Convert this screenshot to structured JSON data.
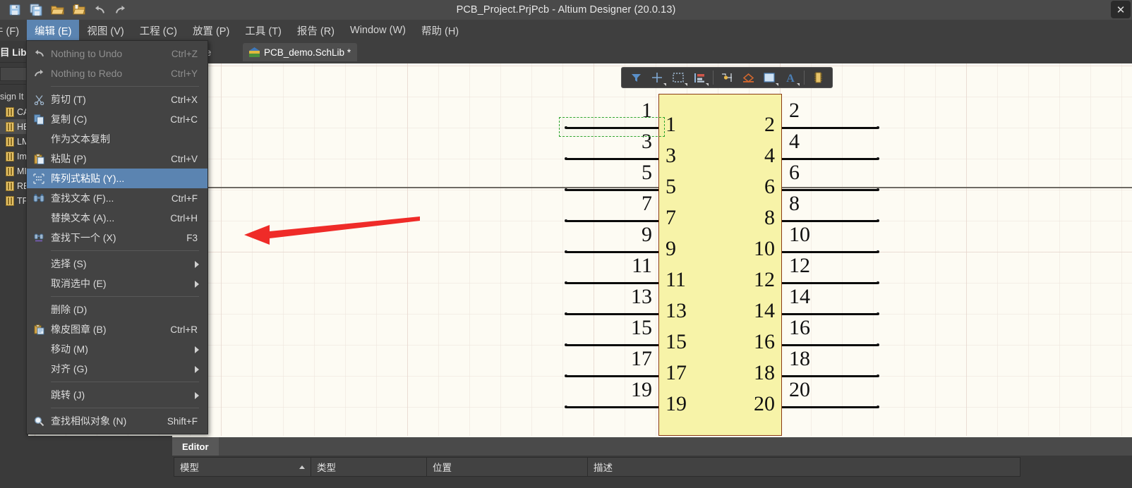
{
  "window": {
    "title": "PCB_Project.PrjPcb - Altium Designer (20.0.13)",
    "close_label": "✕",
    "toolbar_icons": [
      "save-icon",
      "save-all-icon",
      "open-folder-icon",
      "open-project-icon",
      "undo-icon",
      "redo-icon"
    ]
  },
  "menubar": {
    "items": [
      {
        "label": "件 (F)",
        "mnemonic": "F",
        "active": false
      },
      {
        "label": "编辑 (E)",
        "mnemonic": "E",
        "active": true
      },
      {
        "label": "视图 (V)",
        "mnemonic": "V",
        "active": false
      },
      {
        "label": "工程 (C)",
        "mnemonic": "C",
        "active": false
      },
      {
        "label": "放置 (P)",
        "mnemonic": "P",
        "active": false
      },
      {
        "label": "工具 (T)",
        "mnemonic": "T",
        "active": false
      },
      {
        "label": "报告 (R)",
        "mnemonic": "R",
        "active": false
      },
      {
        "label": "Window (W)",
        "mnemonic": "W",
        "active": false
      },
      {
        "label": "帮助 (H)",
        "mnemonic": "H",
        "active": false
      }
    ]
  },
  "edit_menu": {
    "items": [
      {
        "label": "Nothing to Undo",
        "shortcut": "Ctrl+Z",
        "icon": "undo-icon",
        "disabled": true,
        "highlight": false,
        "submenu": false
      },
      {
        "label": "Nothing to Redo",
        "shortcut": "Ctrl+Y",
        "icon": "redo-icon",
        "disabled": true,
        "highlight": false,
        "submenu": false
      },
      {
        "separator": true
      },
      {
        "label": "剪切 (T)",
        "shortcut": "Ctrl+X",
        "icon": "scissors-icon",
        "disabled": false,
        "highlight": false,
        "submenu": false
      },
      {
        "label": "复制 (C)",
        "shortcut": "Ctrl+C",
        "icon": "copy-icon",
        "disabled": false,
        "highlight": false,
        "submenu": false
      },
      {
        "label": "作为文本复制",
        "shortcut": "",
        "icon": "",
        "disabled": false,
        "highlight": false,
        "submenu": false
      },
      {
        "label": "粘贴 (P)",
        "shortcut": "Ctrl+V",
        "icon": "paste-icon",
        "disabled": false,
        "highlight": false,
        "submenu": false
      },
      {
        "label": "阵列式粘贴 (Y)...",
        "shortcut": "",
        "icon": "array-paste-icon",
        "disabled": false,
        "highlight": true,
        "submenu": false
      },
      {
        "label": "查找文本 (F)...",
        "shortcut": "Ctrl+F",
        "icon": "binoculars-icon",
        "disabled": false,
        "highlight": false,
        "submenu": false
      },
      {
        "label": "替换文本 (A)...",
        "shortcut": "Ctrl+H",
        "icon": "",
        "disabled": false,
        "highlight": false,
        "submenu": false
      },
      {
        "label": "查找下一个 (X)",
        "shortcut": "F3",
        "icon": "binoculars-next-icon",
        "disabled": false,
        "highlight": false,
        "submenu": false
      },
      {
        "separator": true
      },
      {
        "label": "选择 (S)",
        "shortcut": "",
        "icon": "",
        "disabled": false,
        "highlight": false,
        "submenu": true
      },
      {
        "label": "取消选中 (E)",
        "shortcut": "",
        "icon": "",
        "disabled": false,
        "highlight": false,
        "submenu": true
      },
      {
        "separator": true
      },
      {
        "label": "删除 (D)",
        "shortcut": "",
        "icon": "",
        "disabled": false,
        "highlight": false,
        "submenu": false
      },
      {
        "label": "橡皮图章 (B)",
        "shortcut": "Ctrl+R",
        "icon": "rubber-stamp-icon",
        "disabled": false,
        "highlight": false,
        "submenu": false
      },
      {
        "label": "移动 (M)",
        "shortcut": "",
        "icon": "",
        "disabled": false,
        "highlight": false,
        "submenu": true
      },
      {
        "label": "对齐 (G)",
        "shortcut": "",
        "icon": "",
        "disabled": false,
        "highlight": false,
        "submenu": true
      },
      {
        "separator": true
      },
      {
        "label": "跳转 (J)",
        "shortcut": "",
        "icon": "",
        "disabled": false,
        "highlight": false,
        "submenu": true
      },
      {
        "separator": true
      },
      {
        "label": "查找相似对象 (N)",
        "shortcut": "Shift+F",
        "icon": "magnifier-icon",
        "disabled": false,
        "highlight": false,
        "submenu": false
      }
    ]
  },
  "left_panel": {
    "title": "目 Libra",
    "section_label": "sign It",
    "items": [
      {
        "label": "CA",
        "selected": false
      },
      {
        "label": "HE",
        "selected": true
      },
      {
        "label": "LM",
        "selected": false
      },
      {
        "label": "Ima",
        "selected": false
      },
      {
        "label": "MI",
        "selected": false
      },
      {
        "label": "RES",
        "selected": false
      },
      {
        "label": "TPS",
        "selected": false
      }
    ]
  },
  "tabs": [
    {
      "label": "ne Page",
      "active": false,
      "icon": ""
    },
    {
      "label": "PCB_demo.SchLib *",
      "active": true,
      "icon": "schlib-icon"
    }
  ],
  "mini_toolbar": {
    "buttons": [
      {
        "name": "filter-icon",
        "caret": false
      },
      {
        "name": "crosshair-icon",
        "caret": true
      },
      {
        "name": "marquee-select-icon",
        "caret": true
      },
      {
        "name": "align-icon",
        "caret": true
      },
      {
        "name": "place-pin-icon",
        "caret": false
      },
      {
        "name": "place-polygon-icon",
        "caret": false
      },
      {
        "name": "place-rectangle-icon",
        "caret": true
      },
      {
        "name": "place-text-icon",
        "caret": true
      },
      {
        "name": "place-component-icon",
        "caret": false
      }
    ]
  },
  "schematic": {
    "component_fill": "#f7f3a8",
    "component_border": "#8a3a14",
    "left_pins": [
      "1",
      "3",
      "5",
      "7",
      "9",
      "11",
      "13",
      "15",
      "17",
      "19"
    ],
    "right_pins": [
      "2",
      "4",
      "6",
      "8",
      "10",
      "12",
      "14",
      "16",
      "18",
      "20"
    ],
    "left_designators": [
      "1",
      "3",
      "5",
      "7",
      "9",
      "11",
      "13",
      "15",
      "17",
      "19"
    ],
    "right_designators": [
      "2",
      "4",
      "6",
      "8",
      "10",
      "12",
      "14",
      "16",
      "18",
      "20"
    ],
    "selected_pin": "1",
    "annotation_arrow_color": "#ef2b28"
  },
  "bottom_panel": {
    "tab_label": "Editor",
    "columns": [
      "模型",
      "类型",
      "位置",
      "描述"
    ],
    "sorted_column": "模型",
    "rows": []
  }
}
